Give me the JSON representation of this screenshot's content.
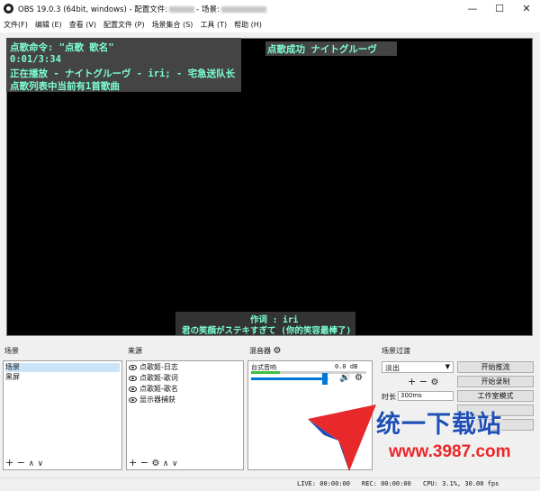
{
  "window": {
    "title_prefix": "OBS 19.0.3 (64bit, windows) - 配置文件:",
    "title_middle": "- 场景:",
    "minimize_glyph": "—",
    "maximize_glyph": "☐",
    "close_glyph": "✕"
  },
  "menu": [
    "文件(F)",
    "编辑 (E)",
    "查看 (V)",
    "配置文件 (P)",
    "场景集合 (S)",
    "工具 (T)",
    "帮助 (H)"
  ],
  "preview": {
    "line1": "点歌命令: \"点歌 歌名\"",
    "line2": "0:01/3:34",
    "line3": "正在播放 - ナイトグルーヴ - iri; - 宅急送队长",
    "line4": "点歌列表中当前有1首歌曲",
    "right": "点歌成功 ナイトグルーヴ",
    "lyric_credit": "作词 : iri",
    "lyric_line": "君の笑顔がステキすぎて (你的笑容最棒了)"
  },
  "scenes": {
    "title": "场景",
    "items": [
      "场景",
      "黑屏"
    ],
    "selected_index": 0,
    "add": "+",
    "remove": "−",
    "up": "∧",
    "down": "∨"
  },
  "sources": {
    "title": "来源",
    "items": [
      "点歌姬-日志",
      "点歌姬-歌词",
      "点歌姬-歌名",
      "显示器捕获"
    ],
    "add": "+",
    "remove": "−",
    "up": "∧",
    "down": "∨"
  },
  "mixer": {
    "title": "混音器",
    "channel_name": "台式音响",
    "level": "0.0 dB",
    "volume_fraction": 0.95
  },
  "transitions": {
    "title": "场景过渡",
    "selected": "淡出",
    "duration_label": "时长",
    "duration_value": "300ms",
    "add": "+",
    "remove": "−"
  },
  "controls": {
    "stream": "开始推流",
    "record": "开始录制",
    "studio": "工作室模式"
  },
  "status": {
    "live": "LIVE: 00:00:00",
    "rec": "REC: 00:00:00",
    "cpu": "CPU: 3.1%, 30.00 fps"
  },
  "watermark": {
    "brand": "统一下载站",
    "site": "www.3987.com"
  },
  "colors": {
    "preview_text": "#7cffd2",
    "preview_bg": "#000000",
    "selection": "#cce4f7",
    "watermark_red": "#e8282b",
    "watermark_blue": "#1f4fb4"
  }
}
